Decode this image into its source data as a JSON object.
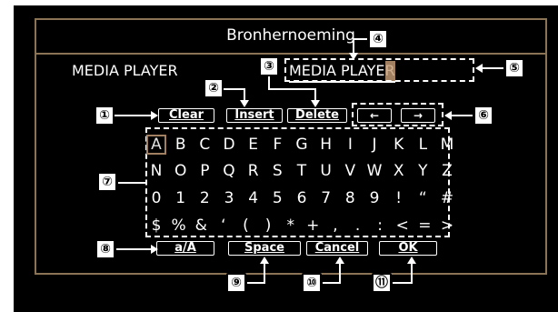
{
  "window": {
    "title": "Bronhernoeming"
  },
  "source": {
    "label": "MEDIA PLAYER"
  },
  "name_input": {
    "value_prefix": "MEDIA PLAYE",
    "cursor_char": "R"
  },
  "buttons": {
    "clear": "Clear",
    "insert": "Insert",
    "delete": "Delete",
    "cursor_left": "←",
    "cursor_right": "→",
    "case_toggle": "a/A",
    "space": "Space",
    "cancel": "Cancel",
    "ok": "OK"
  },
  "keyboard_rows": [
    [
      "A",
      "B",
      "C",
      "D",
      "E",
      "F",
      "G",
      "H",
      "I",
      "J",
      "K",
      "L",
      "M"
    ],
    [
      "N",
      "O",
      "P",
      "Q",
      "R",
      "S",
      "T",
      "U",
      "V",
      "W",
      "X",
      "Y",
      "Z"
    ],
    [
      "0",
      "1",
      "2",
      "3",
      "4",
      "5",
      "6",
      "7",
      "8",
      "9",
      "!",
      "“",
      "#"
    ],
    [
      "$",
      "%",
      "&",
      "‘",
      "(",
      ")",
      "*",
      "+",
      ",",
      ".",
      ":",
      "<",
      "=",
      ">"
    ]
  ],
  "selected_key": "A",
  "callouts": [
    "①",
    "②",
    "③",
    "④",
    "⑤",
    "⑥",
    "⑦",
    "⑧",
    "⑨",
    "⑩",
    "⑪"
  ],
  "colors": {
    "frame": "#8b7355",
    "highlight": "#a08060",
    "background": "#000000",
    "text": "#ffffff"
  }
}
